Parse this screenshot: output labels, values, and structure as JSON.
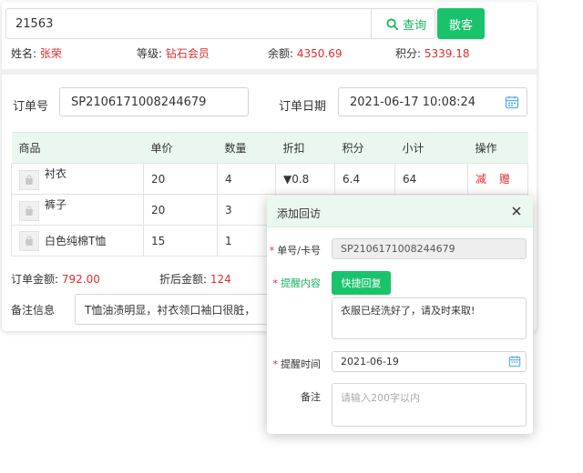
{
  "search": {
    "value": "21563",
    "button_label": "查询",
    "guest_label": "散客"
  },
  "member": {
    "name_label": "姓名:",
    "name": "张荣",
    "level_label": "等级:",
    "level": "钻石会员",
    "balance_label": "余额:",
    "balance": "4350.69",
    "points_label": "积分:",
    "points": "5339.18"
  },
  "order": {
    "no_label": "订单号",
    "no": "SP2106171008244679",
    "date_label": "订单日期",
    "date": "2021-06-17 10:08:24"
  },
  "table": {
    "headers": [
      "商品",
      "单价",
      "数量",
      "折扣",
      "积分",
      "小计",
      "操作"
    ],
    "rows": [
      {
        "name": "衬衣",
        "price": "20",
        "qty": "4",
        "discount": "▼0.8",
        "points": "6.4",
        "subtotal": "64",
        "act1": "减",
        "act2": "赠"
      },
      {
        "name": "裤子",
        "price": "20",
        "qty": "3"
      },
      {
        "name": "白色纯棉T恤",
        "price": "15",
        "qty": "1"
      }
    ]
  },
  "totals": {
    "order_amount_label": "订单金额:",
    "order_amount": "792.00",
    "discounted_label": "折后金额:",
    "discounted": "124"
  },
  "remark": {
    "label": "备注信息",
    "value": "T恤油渍明显，衬衣领口袖口很脏，"
  },
  "modal": {
    "title": "添加回访",
    "card_label": "单号/卡号",
    "card_value": "SP2106171008244679",
    "content_label": "提醒内容",
    "quick_reply_label": "快捷回复",
    "content_value": "衣服已经洗好了，请及时来取!",
    "time_label": "提醒时间",
    "time_value": "2021-06-19",
    "note_label": "备注",
    "note_placeholder": "请输入200字以内"
  },
  "colors": {
    "accent": "#19c36b",
    "price_red": "#e02c2c",
    "header_bg": "#e9f7ee"
  },
  "icons": [
    "search-icon",
    "calendar-icon",
    "product-image-icon",
    "close-icon"
  ]
}
